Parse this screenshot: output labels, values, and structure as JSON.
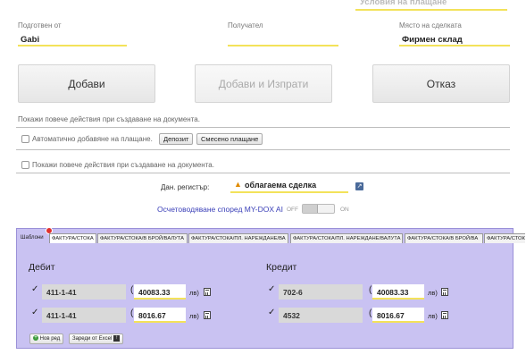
{
  "header": {
    "payment_terms_label": "Условия на плащане",
    "prepared_by_label": "Подготвен от",
    "prepared_by_value": "Gabi",
    "recipient_label": "Получател",
    "recipient_value": "",
    "deal_place_label": "Място на сделката",
    "deal_place_value": "Фирмен склад"
  },
  "actions": {
    "add_label": "Добави",
    "add_send_label": "Добави и Изпрати",
    "cancel_label": "Отказ"
  },
  "options": {
    "more_actions_text": "Покажи повече действия при създаване на документа.",
    "auto_payment_label": "Автоматично добавяне на плащане.",
    "deposit_label": "Депозит",
    "mixed_payment_label": "Смесено плащане",
    "more_actions_checkbox_label": "Покажи повече действия при създаване на документа."
  },
  "tax": {
    "register_label": "Дан. регистър:",
    "register_value": "облагаема сделка",
    "mydox_label": "Осчетоводяване според MY-DOX AI",
    "toggle_off": "OFF",
    "toggle_on": "ON"
  },
  "templates": {
    "label": "Шаблони",
    "badge_count": "",
    "tabs": [
      "ФАКТУРА/СТОКА",
      "ФАКТУРА/СТОКА/В БРОЙ/ВАЛУТА",
      "ФАКТУРА/СТОКА/ПЛ. НАРЕЖДАНЕ/ВА",
      "ФАКТУРА/СТОКА/ПЛ. НАРЕЖДАНЕ/ВАЛУТА",
      "ФАКТУРА/СТОКА/В БРОЙ/ВА",
      "ФАКТУРА/СТОКА/В БРО"
    ]
  },
  "ledger": {
    "debit_title": "Дебит",
    "credit_title": "Кредит",
    "currency": "лв)",
    "debit_rows": [
      {
        "account": "411-1-41",
        "amount": "40083.33"
      },
      {
        "account": "411-1-41",
        "amount": "8016.67"
      }
    ],
    "credit_rows": [
      {
        "account": "702-6",
        "amount": "40083.33"
      },
      {
        "account": "4532",
        "amount": "8016.67"
      }
    ],
    "new_row_label": "Нов ред",
    "load_excel_label": "Зареди от Excel"
  },
  "colors": {
    "accent_yellow": "#f3e25a",
    "panel_purple": "#c9c2f2",
    "panel_border": "#9a90d8",
    "mydox_blue": "#3a3fb8"
  }
}
